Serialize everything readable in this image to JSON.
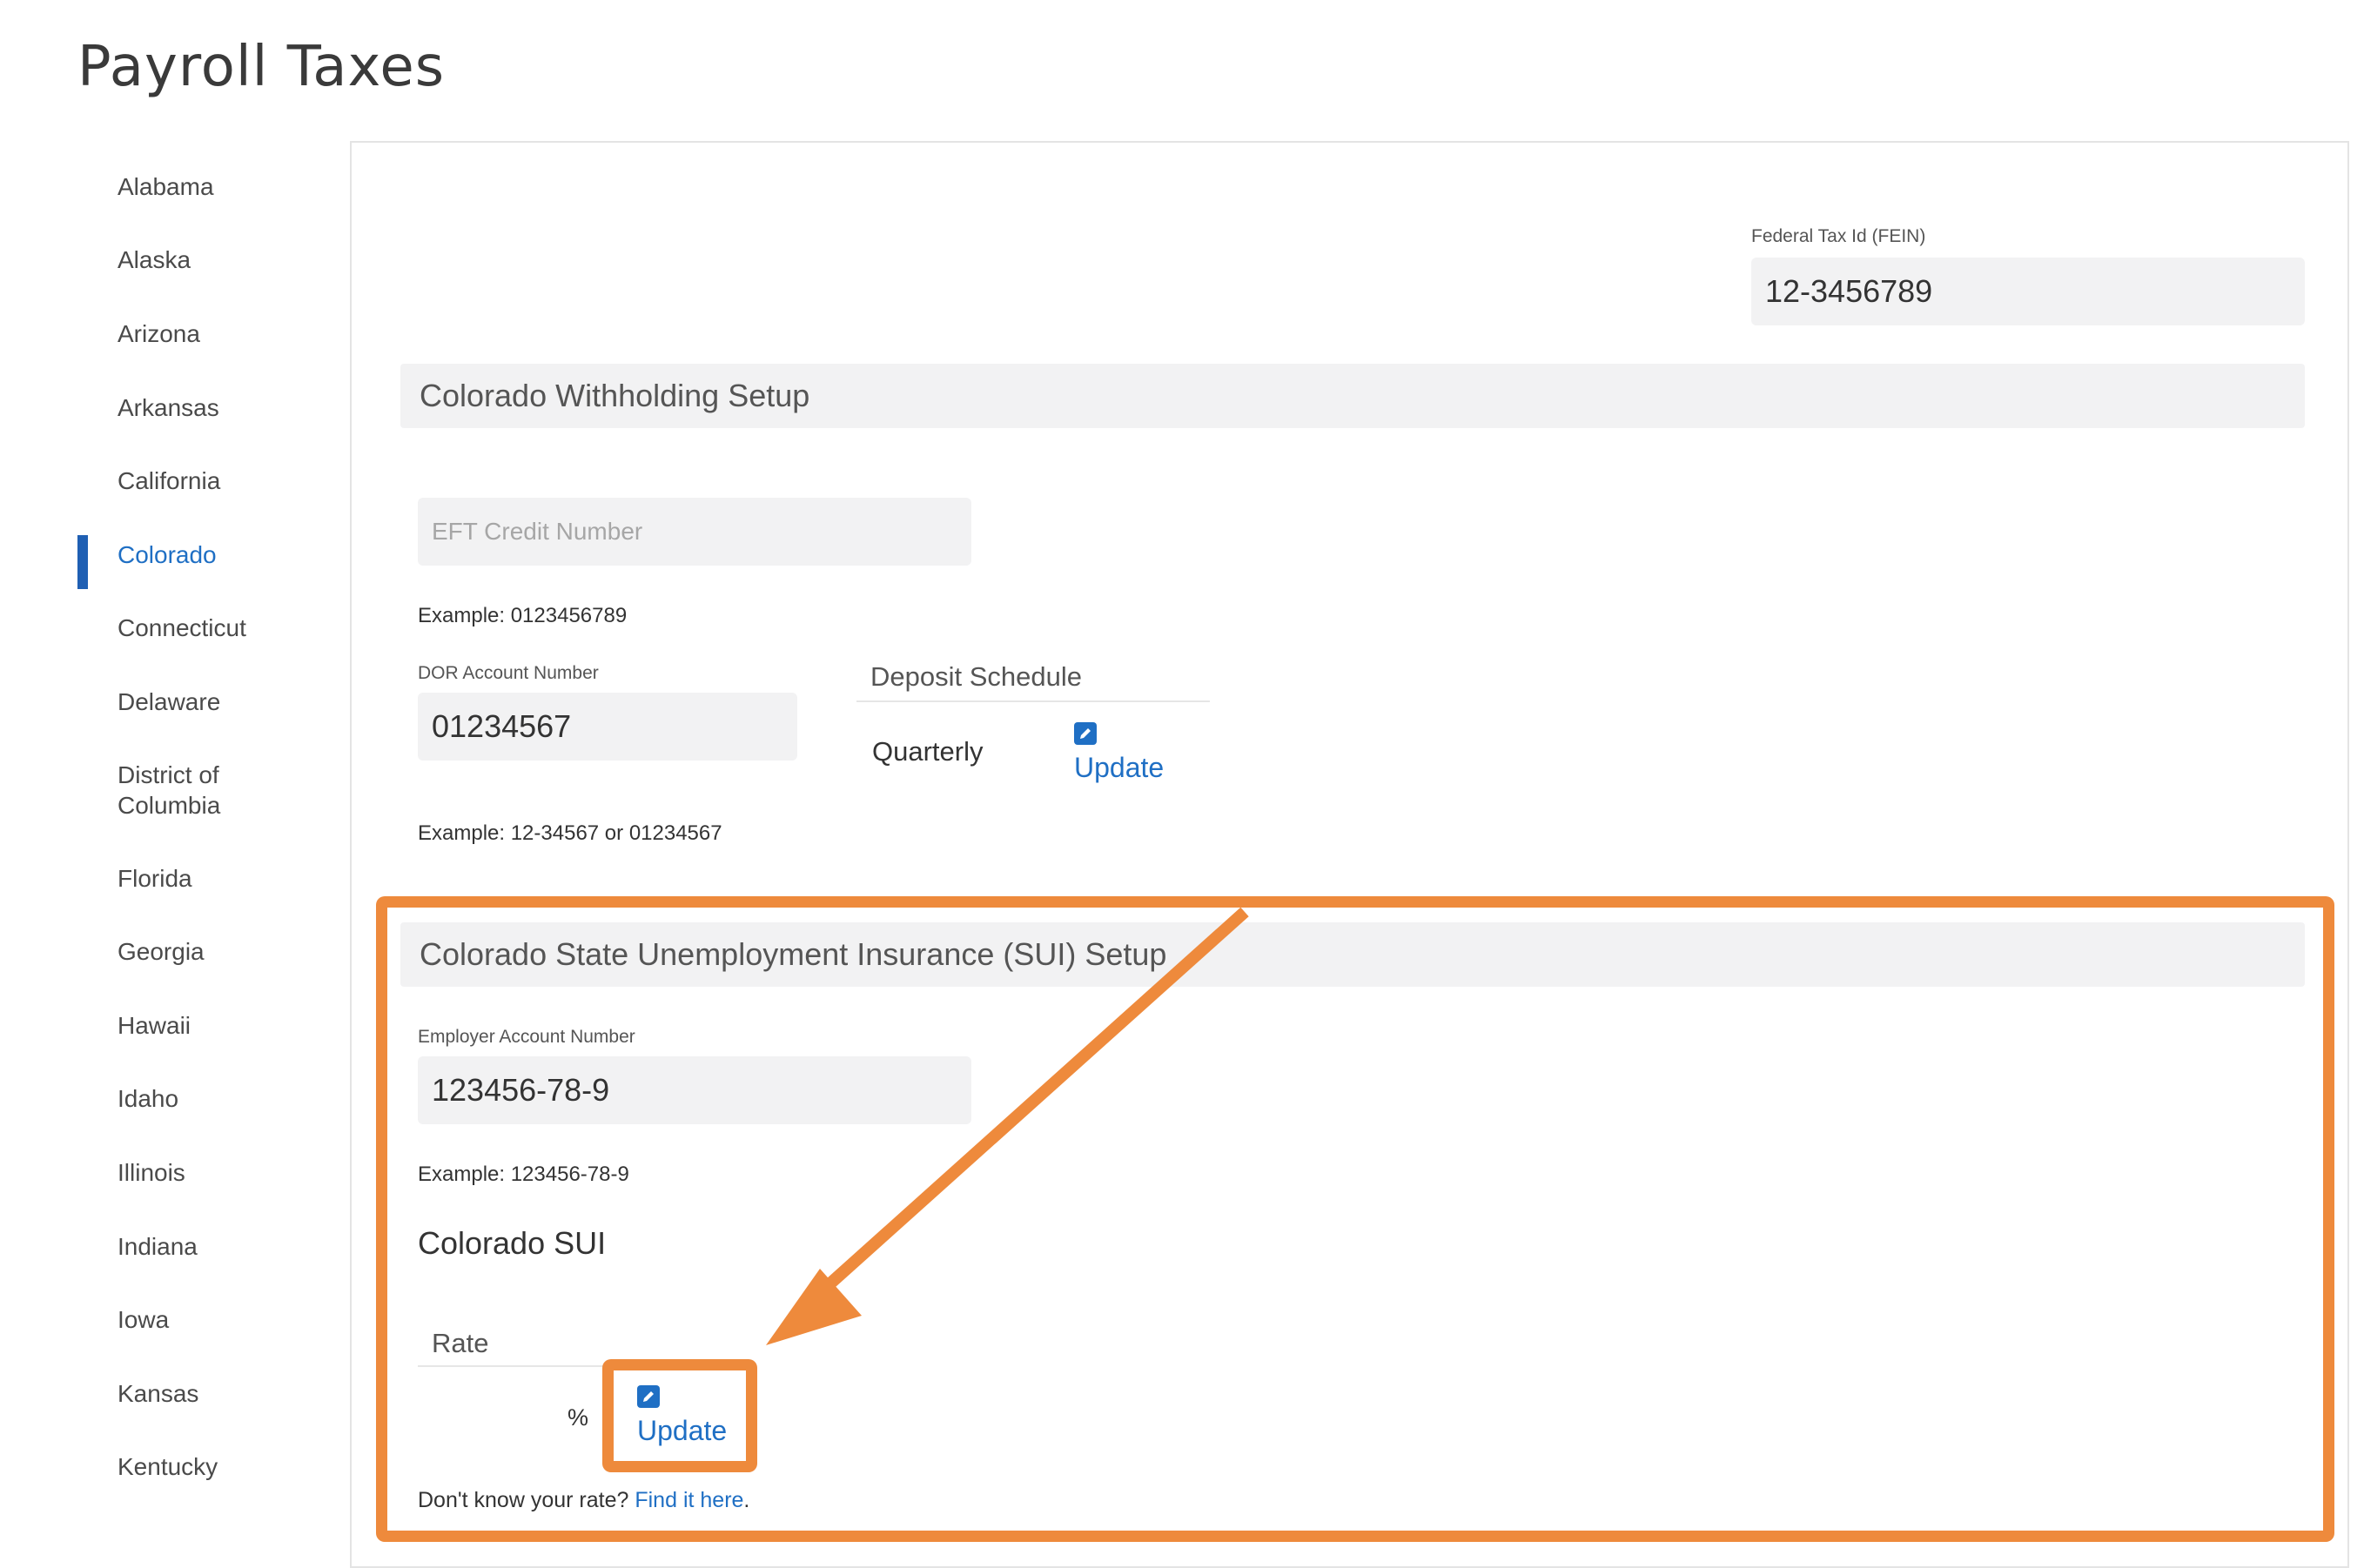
{
  "page_title": "Payroll Taxes",
  "sidebar": {
    "items": [
      {
        "label": "Alabama"
      },
      {
        "label": "Alaska"
      },
      {
        "label": "Arizona"
      },
      {
        "label": "Arkansas"
      },
      {
        "label": "California"
      },
      {
        "label": "Colorado",
        "active": true
      },
      {
        "label": "Connecticut"
      },
      {
        "label": "Delaware"
      },
      {
        "label": "District of Columbia"
      },
      {
        "label": "Florida"
      },
      {
        "label": "Georgia"
      },
      {
        "label": "Hawaii"
      },
      {
        "label": "Idaho"
      },
      {
        "label": "Illinois"
      },
      {
        "label": "Indiana"
      },
      {
        "label": "Iowa"
      },
      {
        "label": "Kansas"
      },
      {
        "label": "Kentucky"
      }
    ]
  },
  "fein": {
    "label": "Federal Tax Id (FEIN)",
    "value": "12-3456789"
  },
  "withholding": {
    "title": "Colorado Withholding Setup",
    "eft": {
      "placeholder": "EFT Credit Number",
      "example": "Example: 0123456789"
    },
    "dor": {
      "label": "DOR Account Number",
      "value": "01234567",
      "example": "Example: 12-34567 or 01234567"
    },
    "deposit": {
      "header": "Deposit Schedule",
      "value": "Quarterly",
      "update_label": "Update"
    }
  },
  "sui": {
    "title": "Colorado State Unemployment Insurance (SUI) Setup",
    "employer": {
      "label": "Employer Account Number",
      "value": "123456-78-9",
      "example": "Example: 123456-78-9"
    },
    "subtitle": "Colorado SUI",
    "rate": {
      "header": "Rate",
      "suffix": "%",
      "update_label": "Update"
    },
    "help": {
      "prefix": "Don't know your rate?",
      "link": "Find it here",
      "suffix": "."
    }
  },
  "colors": {
    "accent": "#1f6fc4",
    "highlight": "#ee8a3c"
  },
  "icons": {
    "edit": "pencil-edit-icon"
  }
}
